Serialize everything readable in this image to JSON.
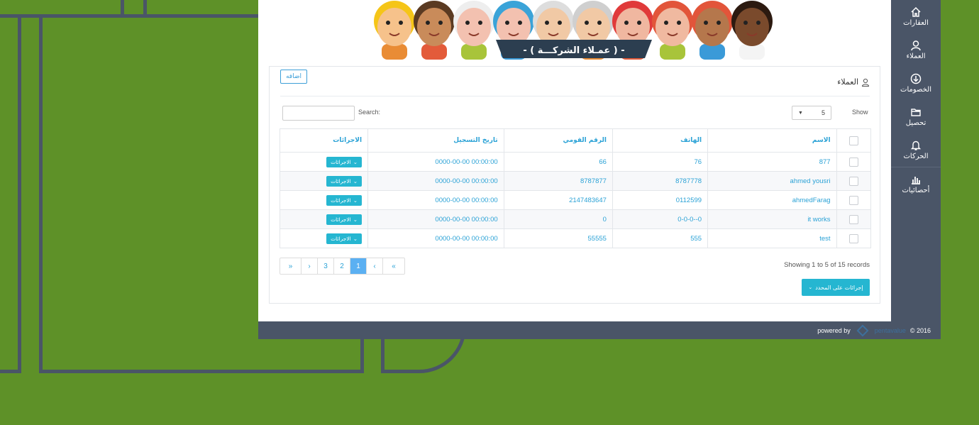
{
  "banner": {
    "title": "- ( عمـلاء الشركـــة ) -"
  },
  "sidebar": {
    "items": [
      {
        "label": "العقارات",
        "icon": "home-icon"
      },
      {
        "label": "العملاء",
        "icon": "user-icon"
      },
      {
        "label": "الخصومات",
        "icon": "download-circle-icon"
      },
      {
        "label": "تحصيل",
        "icon": "folder-icon"
      },
      {
        "label": "الحركات",
        "icon": "bell-icon"
      },
      {
        "label": "أحصائيات",
        "icon": "bar-chart-icon"
      }
    ]
  },
  "panel": {
    "title": "العملاء",
    "add_label": "اضافه",
    "search_label": "Search:",
    "show_label": "Show",
    "show_value": "5"
  },
  "table": {
    "headers": [
      "الاسم",
      "الهاتف",
      "الرقم القومي",
      "تاريخ التسجيل",
      "الاجرائات"
    ],
    "rows": [
      {
        "name": "877",
        "phone": "76",
        "national_id": "66",
        "date": "0000-00-00 00:00:00",
        "action": "الاجرائات"
      },
      {
        "name": "ahmed yousri",
        "phone": "8787778",
        "national_id": "8787877",
        "date": "0000-00-00 00:00:00",
        "action": "الاجرائات"
      },
      {
        "name": "ahmedFarag",
        "phone": "0112599",
        "national_id": "2147483647",
        "date": "0000-00-00 00:00:00",
        "action": "الاجرائات"
      },
      {
        "name": "it works",
        "phone": "0-0-0--0",
        "national_id": "0",
        "date": "0000-00-00 00:00:00",
        "action": "الاجرائات"
      },
      {
        "name": "test",
        "phone": "555",
        "national_id": "55555",
        "date": "0000-00-00 00:00:00",
        "action": "الاجرائات"
      }
    ]
  },
  "pagination": {
    "first": "«",
    "prev": "‹",
    "pages": [
      "3",
      "2",
      "1"
    ],
    "active_page": "1",
    "next": "›",
    "last": "»"
  },
  "records_text": "Showing 1 to 5 of 15 records",
  "bulk_actions_label": "إجرائات على المحدد",
  "footer": {
    "powered_by": "powered by",
    "brand": "pentavalue",
    "copyright": "© 2016"
  },
  "colors": {
    "background": "#5e9128",
    "sidebar": "#4a5567",
    "accent": "#25b6d1",
    "link": "#2ba2d6",
    "active_page": "#5bb0f2"
  }
}
